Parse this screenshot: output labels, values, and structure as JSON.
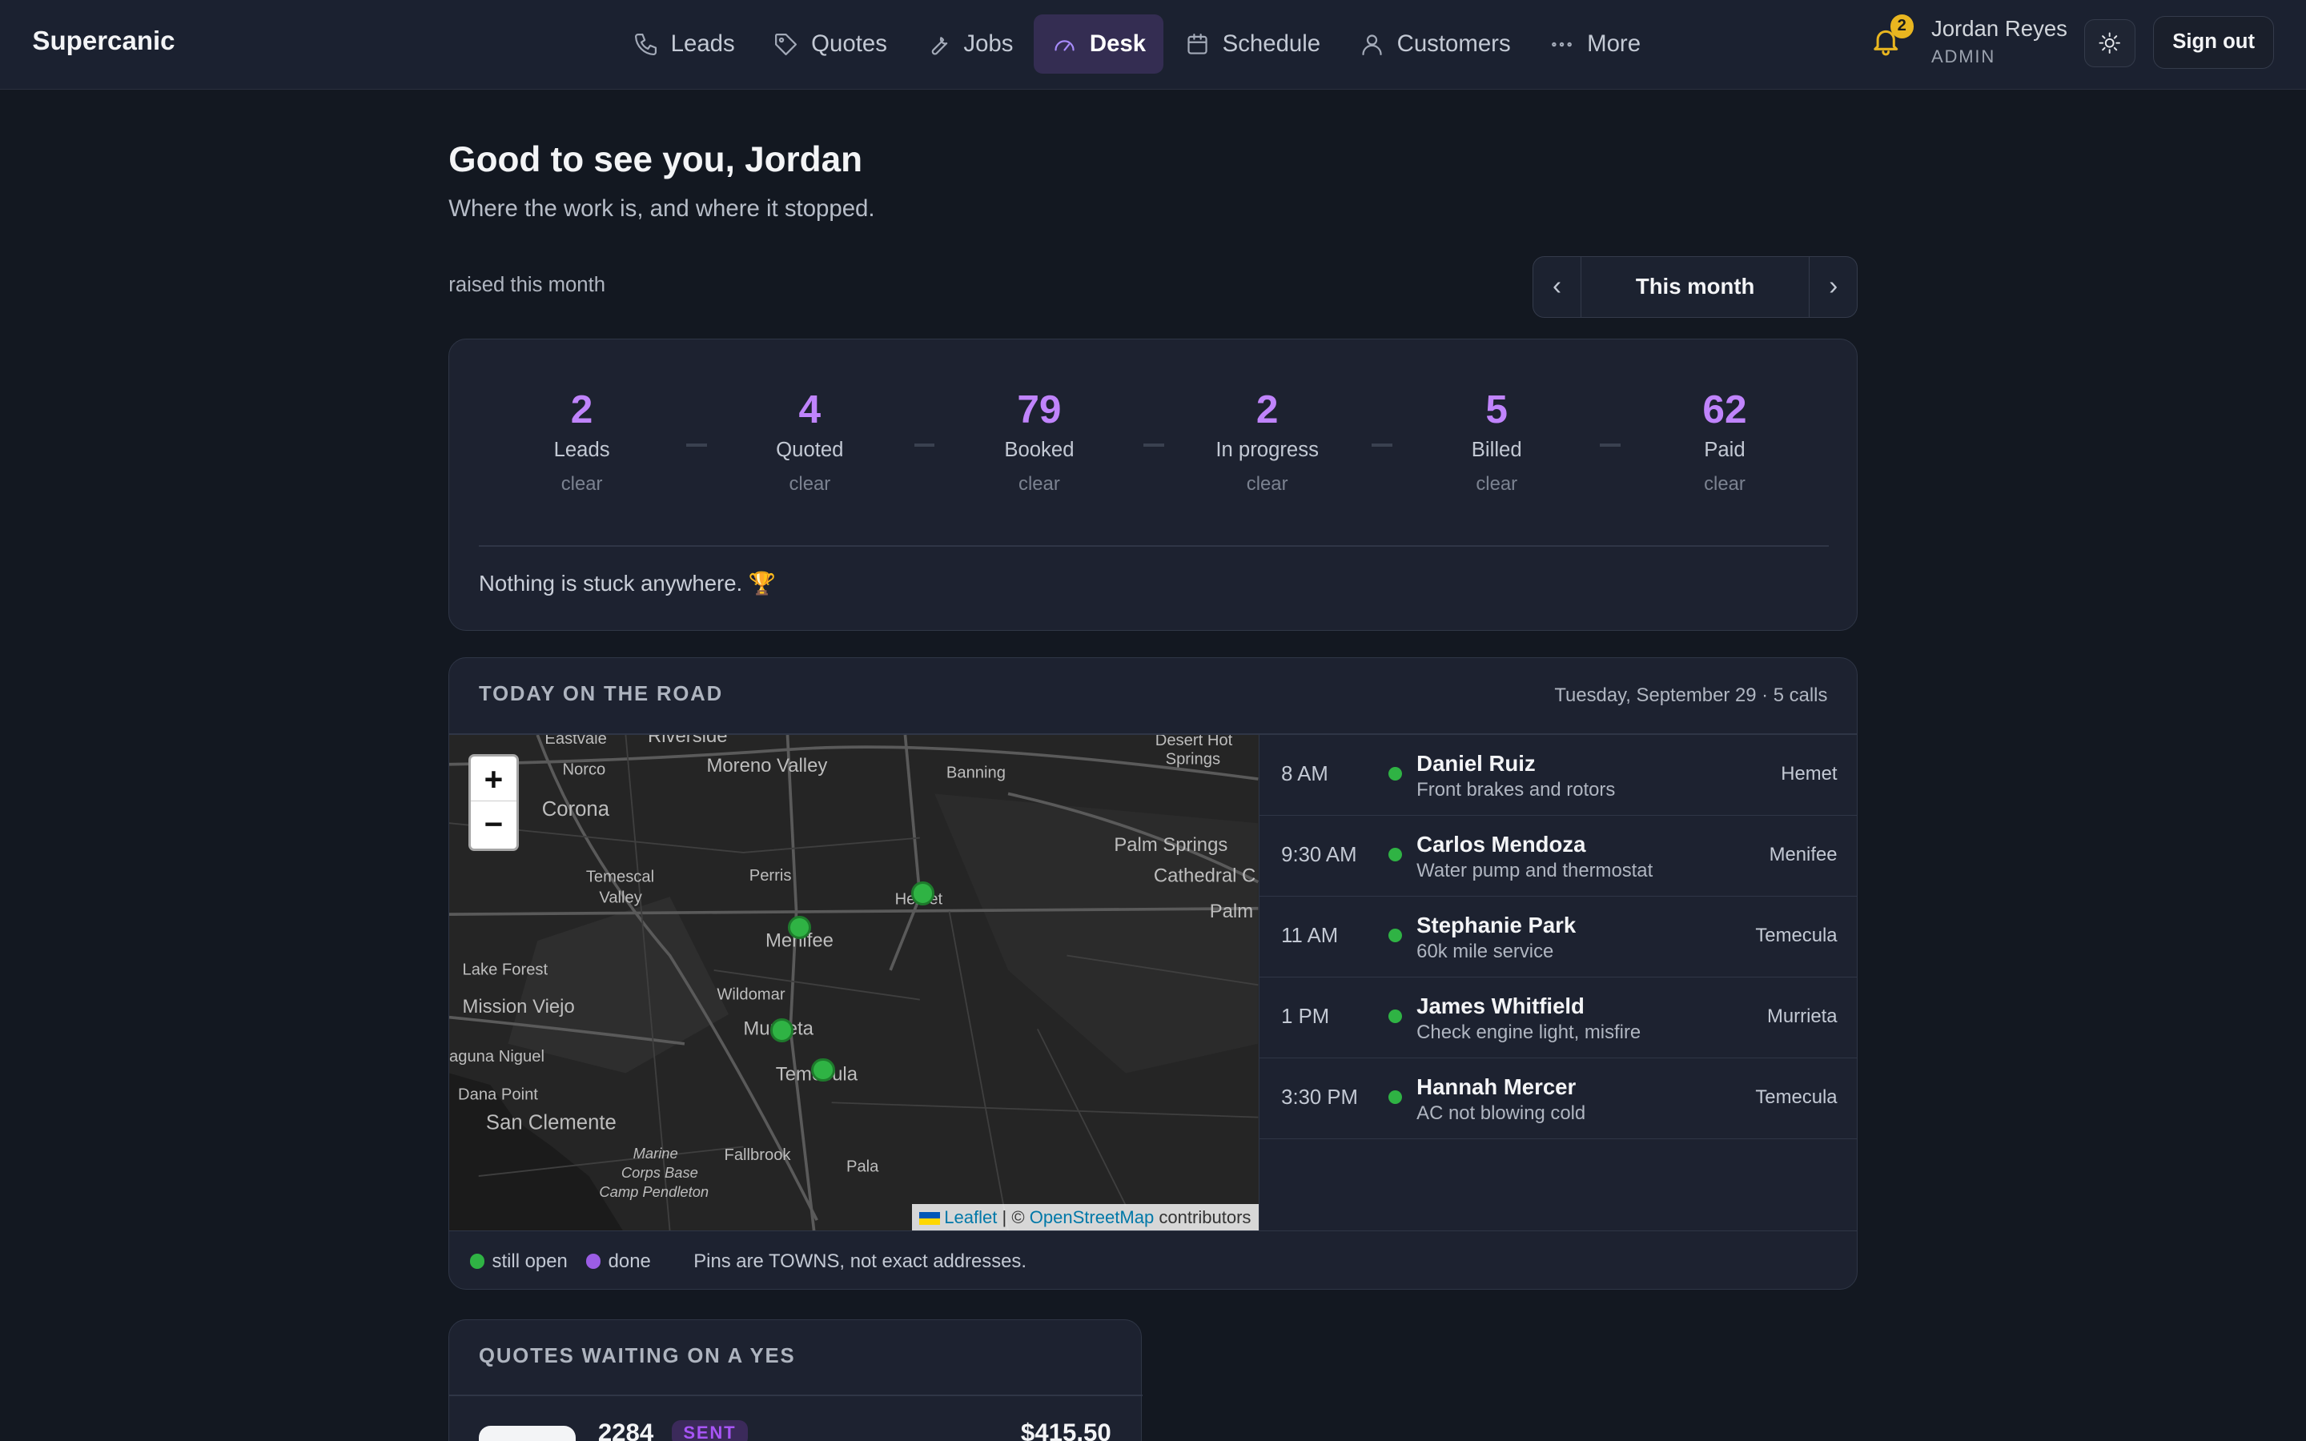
{
  "app": {
    "brand": "Supercanic"
  },
  "nav": {
    "items": [
      {
        "label": "Leads",
        "icon": "phone-icon"
      },
      {
        "label": "Quotes",
        "icon": "tag-icon"
      },
      {
        "label": "Jobs",
        "icon": "wrench-icon"
      },
      {
        "label": "Desk",
        "icon": "gauge-icon",
        "active": true
      },
      {
        "label": "Schedule",
        "icon": "calendar-icon"
      },
      {
        "label": "Customers",
        "icon": "user-icon"
      },
      {
        "label": "More",
        "icon": "more-icon"
      }
    ]
  },
  "header": {
    "notifications_count": "2",
    "user_name": "Jordan Reyes",
    "user_role": "ADMIN",
    "theme_icon": "sun-icon",
    "signout_label": "Sign out"
  },
  "page": {
    "greeting": "Good to see you, Jordan",
    "subtitle": "Where the work is, and where it stopped.",
    "raised_label": "raised this month",
    "period_label": "This month",
    "period_prev": "‹",
    "period_next": "›"
  },
  "pipeline": {
    "stages": [
      {
        "count": "2",
        "label": "Leads",
        "status": "clear"
      },
      {
        "count": "4",
        "label": "Quoted",
        "status": "clear"
      },
      {
        "count": "79",
        "label": "Booked",
        "status": "clear"
      },
      {
        "count": "2",
        "label": "In progress",
        "status": "clear"
      },
      {
        "count": "5",
        "label": "Billed",
        "status": "clear"
      },
      {
        "count": "62",
        "label": "Paid",
        "status": "clear"
      }
    ],
    "stuck_message": "Nothing is stuck anywhere. 🏆"
  },
  "road": {
    "title": "TODAY ON THE ROAD",
    "date_summary": "Tuesday, September 29 · 5 calls",
    "zoom_in": "+",
    "zoom_out": "−",
    "attribution": {
      "leaflet": "Leaflet",
      "separator": " | © ",
      "osm": "OpenStreetMap",
      "suffix": " contributors"
    },
    "map_labels": {
      "eastvale": "Eastvale",
      "riverside": "Riverside",
      "norco": "Norco",
      "moreno_valley": "Moreno Valley",
      "banning": "Banning",
      "desert_hot_springs_1": "Desert Hot",
      "desert_hot_springs_2": "Springs",
      "corona": "Corona",
      "perris": "Perris",
      "temescal_valley_1": "Temescal",
      "temescal_valley_2": "Valley",
      "hemet": "Hemet",
      "palm_springs": "Palm Springs",
      "cathedral_city": "Cathedral C",
      "palm": "Palm",
      "menifee": "Menifee",
      "lake_forest": "Lake Forest",
      "mission_viejo": "Mission Viejo",
      "wildomar": "Wildomar",
      "murrieta": "Murrieta",
      "laguna_niguel": "aguna Niguel",
      "temecula": "Temecula",
      "dana_point": "Dana Point",
      "san_clemente": "San Clemente",
      "marine_1": "Marine",
      "marine_2": "Corps Base",
      "marine_3": "Camp Pendleton",
      "fallbrook": "Fallbrook",
      "pala": "Pala"
    },
    "calls": [
      {
        "time": "8 AM",
        "name": "Daniel Ruiz",
        "job": "Front brakes and rotors",
        "town": "Hemet"
      },
      {
        "time": "9:30 AM",
        "name": "Carlos Mendoza",
        "job": "Water pump and thermostat",
        "town": "Menifee"
      },
      {
        "time": "11 AM",
        "name": "Stephanie Park",
        "job": "60k mile service",
        "town": "Temecula"
      },
      {
        "time": "1 PM",
        "name": "James Whitfield",
        "job": "Check engine light, misfire",
        "town": "Murrieta"
      },
      {
        "time": "3:30 PM",
        "name": "Hannah Mercer",
        "job": "AC not blowing cold",
        "town": "Temecula"
      }
    ],
    "legend": {
      "open": "still open",
      "done": "done",
      "note": "Pins are TOWNS, not exact addresses."
    }
  },
  "quotes": {
    "title": "QUOTES WAITING ON A YES",
    "items": [
      {
        "number": "2284",
        "status": "SENT",
        "amount": "$415.50"
      }
    ]
  },
  "colors": {
    "accent": "#c084fc",
    "active_nav_bg": "#342d52",
    "open_status": "#2fb344",
    "done_status": "#9b5de5",
    "bell": "#e9b620"
  }
}
